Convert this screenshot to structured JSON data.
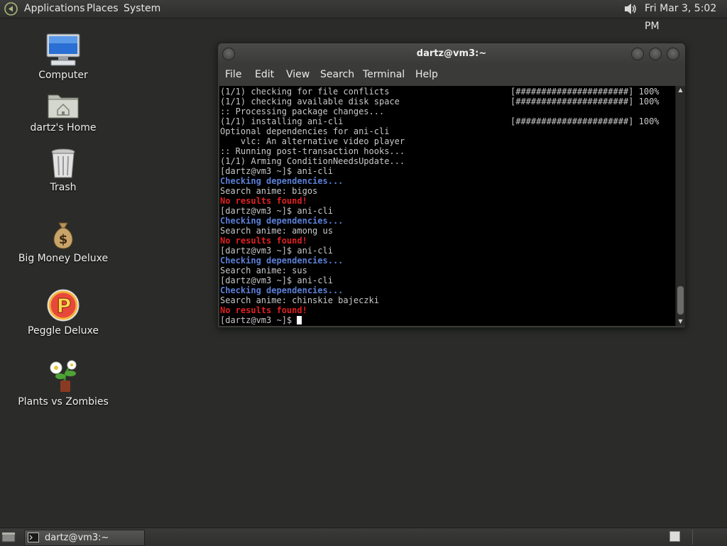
{
  "top_panel": {
    "menus": [
      "Applications",
      "Places",
      "System"
    ],
    "clock": "Fri Mar  3,  5:02 PM"
  },
  "desktop_icons": [
    {
      "label": "Computer",
      "icon": "computer-icon"
    },
    {
      "label": "dartz's Home",
      "icon": "home-folder-icon"
    },
    {
      "label": "Trash",
      "icon": "trash-icon"
    },
    {
      "label": "Big Money Deluxe",
      "icon": "money-bag-icon"
    },
    {
      "label": "Peggle Deluxe",
      "icon": "peggle-icon"
    },
    {
      "label": "Plants vs Zombies",
      "icon": "plants-vs-zombies-icon"
    }
  ],
  "terminal": {
    "title": "dartz@vm3:~",
    "menu": [
      "File",
      "Edit",
      "View",
      "Search",
      "Terminal",
      "Help"
    ],
    "lines": [
      {
        "text": "(1/1) checking for file conflicts",
        "style": "",
        "progress": "[######################] 100%"
      },
      {
        "text": "(1/1) checking available disk space",
        "style": "",
        "progress": "[######################] 100%"
      },
      {
        "text": ":: Processing package changes...",
        "style": "",
        "progress": ""
      },
      {
        "text": "(1/1) installing ani-cli",
        "style": "",
        "progress": "[######################] 100%"
      },
      {
        "text": "Optional dependencies for ani-cli",
        "style": "",
        "progress": ""
      },
      {
        "text": "    vlc: An alternative video player",
        "style": "",
        "progress": ""
      },
      {
        "text": ":: Running post-transaction hooks...",
        "style": "",
        "progress": ""
      },
      {
        "text": "(1/1) Arming ConditionNeedsUpdate...",
        "style": "",
        "progress": ""
      },
      {
        "text": "[dartz@vm3 ~]$ ani-cli",
        "style": "",
        "progress": ""
      },
      {
        "text": "Checking dependencies...",
        "style": "blue",
        "progress": ""
      },
      {
        "text": "Search anime: bigos",
        "style": "",
        "progress": ""
      },
      {
        "text": "No results found!",
        "style": "red",
        "progress": ""
      },
      {
        "text": "[dartz@vm3 ~]$ ani-cli",
        "style": "",
        "progress": ""
      },
      {
        "text": "Checking dependencies...",
        "style": "blue",
        "progress": ""
      },
      {
        "text": "Search anime: among us",
        "style": "",
        "progress": ""
      },
      {
        "text": "No results found!",
        "style": "red",
        "progress": ""
      },
      {
        "text": "[dartz@vm3 ~]$ ani-cli",
        "style": "",
        "progress": ""
      },
      {
        "text": "Checking dependencies...",
        "style": "blue",
        "progress": ""
      },
      {
        "text": "Search anime: sus",
        "style": "",
        "progress": ""
      },
      {
        "text": "[dartz@vm3 ~]$ ani-cli",
        "style": "",
        "progress": ""
      },
      {
        "text": "Checking dependencies...",
        "style": "blue",
        "progress": ""
      },
      {
        "text": "Search anime: chinskie bajeczki",
        "style": "",
        "progress": ""
      },
      {
        "text": "No results found!",
        "style": "red",
        "progress": ""
      }
    ],
    "prompt": "[dartz@vm3 ~]$ "
  },
  "taskbar": {
    "window_label": "dartz@vm3:~"
  }
}
